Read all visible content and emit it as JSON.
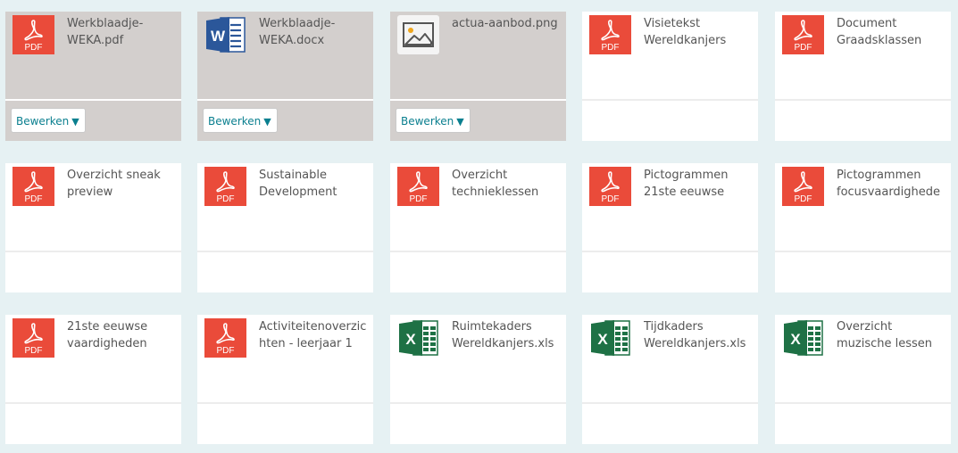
{
  "colors": {
    "background": "#e6f1f3",
    "tile": "#ffffff",
    "tile_selected": "#d3cfcd",
    "pdf": "#ea4b3a",
    "word": "#2b579a",
    "excel": "#1e7145",
    "accent": "#0a7f8f"
  },
  "edit_label": "Bewerken",
  "edit_caret": "▼",
  "pdf_icon_text": "PDF",
  "word_icon_text": "W",
  "excel_icon_text": "X",
  "files": [
    {
      "name": "Werkblaadje-WEKA.pdf",
      "icon": "pdf-icon",
      "selected": true
    },
    {
      "name": "Werkblaadje-WEKA.docx",
      "icon": "word-icon",
      "selected": true
    },
    {
      "name": "actua-aanbod.png",
      "icon": "image-icon",
      "selected": true
    },
    {
      "name": "Visietekst Wereldkanjers",
      "icon": "pdf-icon",
      "selected": false
    },
    {
      "name": "Document Graadsklassen",
      "icon": "pdf-icon",
      "selected": false
    },
    {
      "name": "Overzicht sneak preview",
      "icon": "pdf-icon",
      "selected": false
    },
    {
      "name": "Sustainable Development Goals",
      "icon": "pdf-icon",
      "selected": false
    },
    {
      "name": "Overzicht technieklessen per",
      "icon": "pdf-icon",
      "selected": false
    },
    {
      "name": "Pictogrammen 21ste eeuwse",
      "icon": "pdf-icon",
      "selected": false
    },
    {
      "name": "Pictogrammen focusvaardigheden.p",
      "icon": "pdf-icon",
      "selected": false
    },
    {
      "name": "21ste eeuwse vaardigheden",
      "icon": "pdf-icon",
      "selected": false
    },
    {
      "name": "Activiteitenoverzichten - leerjaar 1",
      "icon": "pdf-icon",
      "selected": false
    },
    {
      "name": "Ruimtekaders Wereldkanjers.xlsx",
      "icon": "excel-icon",
      "selected": false
    },
    {
      "name": "Tijdkaders Wereldkanjers.xlsx",
      "icon": "excel-icon",
      "selected": false
    },
    {
      "name": "Overzicht muzische lessen Wereldkanjers",
      "icon": "excel-icon",
      "selected": false
    }
  ]
}
